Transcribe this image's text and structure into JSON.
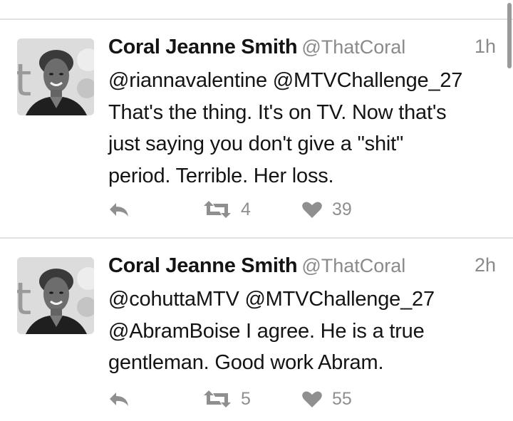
{
  "tweets": [
    {
      "author_name": "Coral Jeanne Smith",
      "handle": "@ThatCoral",
      "time": "1h",
      "text_lines": [
        "@riannavalentine @MTVChallenge_27",
        "That's the thing. It's on TV. Now that's",
        "just saying you don't give a \"shit\"",
        "period. Terrible. Her loss."
      ],
      "retweets": "4",
      "likes": "39"
    },
    {
      "author_name": "Coral Jeanne Smith",
      "handle": "@ThatCoral",
      "time": "2h",
      "text_lines": [
        "@cohuttaMTV @MTVChallenge_27",
        "@AbramBoise I agree. He is a true",
        "gentleman. Good work Abram."
      ],
      "retweets": "5",
      "likes": "55"
    }
  ],
  "icons": {
    "reply": "reply-icon",
    "retweet": "retweet-icon",
    "like": "heart-icon"
  },
  "colors": {
    "text": "#141414",
    "muted": "#8a8a8a",
    "divider": "#e1e1e1"
  }
}
